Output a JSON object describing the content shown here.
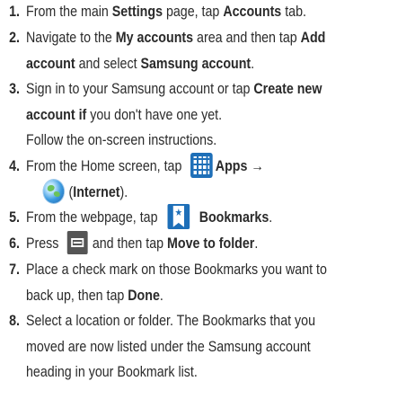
{
  "steps": [
    {
      "number": "1.",
      "lines": [
        [
          {
            "t": "From the main "
          },
          {
            "t": "Settings",
            "b": true
          },
          {
            "t": " page, tap "
          },
          {
            "t": "Accounts",
            "b": true
          },
          {
            "t": " tab."
          }
        ]
      ]
    },
    {
      "number": "2.",
      "lines": [
        [
          {
            "t": "Navigate to the "
          },
          {
            "t": "My accounts",
            "b": true
          },
          {
            "t": " area and then tap "
          },
          {
            "t": "Add",
            "b": true
          }
        ],
        [
          {
            "t": "account",
            "b": true
          },
          {
            "t": " and select "
          },
          {
            "t": "Samsung account",
            "b": true
          },
          {
            "t": "."
          }
        ]
      ]
    },
    {
      "number": "3.",
      "lines": [
        [
          {
            "t": "Sign in to your Samsung account or tap "
          },
          {
            "t": "Create new",
            "b": true
          }
        ],
        [
          {
            "t": "account if",
            "b": true
          },
          {
            "t": " you don't have one yet."
          }
        ],
        [
          {
            "t": "Follow the on-screen instructions."
          }
        ]
      ]
    },
    {
      "number": "4.",
      "lines": [
        [
          {
            "t": "From the Home screen, tap "
          },
          {
            "icon": "apps-grid-icon"
          },
          {
            "t": "Apps",
            "b": true
          },
          {
            "t": " →"
          }
        ],
        [
          {
            "icon": "internet-globe-icon"
          },
          {
            "t": "("
          },
          {
            "t": "Internet",
            "b": true
          },
          {
            "t": ")."
          }
        ]
      ]
    },
    {
      "number": "5.",
      "lines": [
        [
          {
            "t": "From the webpage, tap "
          },
          {
            "icon": "bookmark-icon"
          },
          {
            "t": "Bookmarks",
            "b": true
          },
          {
            "t": "."
          }
        ]
      ]
    },
    {
      "number": "6.",
      "lines": [
        [
          {
            "t": "Press "
          },
          {
            "icon": "menu-key-icon"
          },
          {
            "t": "and then tap "
          },
          {
            "t": "Move to folder",
            "b": true
          },
          {
            "t": "."
          }
        ]
      ]
    },
    {
      "number": "7.",
      "lines": [
        [
          {
            "t": "Place a check mark on those Bookmarks you want to"
          }
        ],
        [
          {
            "t": "back up, then tap "
          },
          {
            "t": "Done",
            "b": true
          },
          {
            "t": "."
          }
        ]
      ]
    },
    {
      "number": "8.",
      "lines": [
        [
          {
            "t": "Select a location or folder. The Bookmarks that you"
          }
        ],
        [
          {
            "t": "moved are now listed under the Samsung account"
          }
        ],
        [
          {
            "t": "heading in your Bookmark list."
          }
        ]
      ]
    }
  ]
}
